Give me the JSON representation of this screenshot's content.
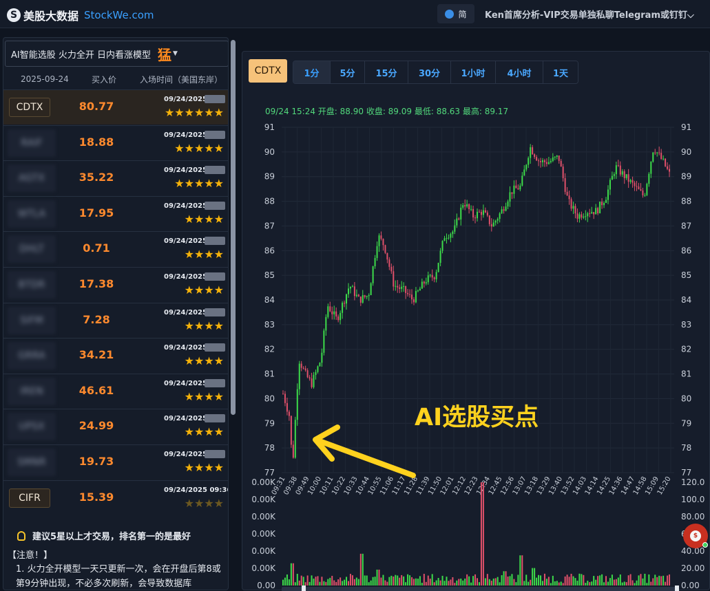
{
  "header": {
    "logo_mark": "S",
    "brand": "美股大数据",
    "site": "StockWe.com",
    "lang": "简",
    "user_menu": "Ken首席分析-VIP交易单独私聊Telegram或钉钉"
  },
  "picker": {
    "model": "AI智能选股 火力全开 日内看涨模型",
    "hot_tag": "猛",
    "date": "2025-09-24",
    "col_price": "买入价",
    "col_time": "入场时间（美国东岸）",
    "rows": [
      {
        "ticker": "CDTX",
        "price": "80.77",
        "time": "09/24/2025",
        "stars": "★★★★★★",
        "active": true
      },
      {
        "ticker": "RAIF",
        "price": "18.88",
        "time": "09/24/2025 09:",
        "stars": "★★★★★",
        "blur": true
      },
      {
        "ticker": "AGTX",
        "price": "35.22",
        "time": "09/24/2025",
        "stars": "★★★★★",
        "blur": true
      },
      {
        "ticker": "WTLA",
        "price": "17.95",
        "time": "09/24/2025",
        "stars": "★★★★",
        "blur": true
      },
      {
        "ticker": "DHLT",
        "price": "0.71",
        "time": "09/24/2025",
        "stars": "★★★★",
        "blur": true
      },
      {
        "ticker": "BTDR",
        "price": "17.38",
        "time": "09/24/2025",
        "stars": "★★★★",
        "blur": true
      },
      {
        "ticker": "SIFM",
        "price": "7.28",
        "time": "09/24/2025",
        "stars": "★★★★",
        "blur": true
      },
      {
        "ticker": "GRRA",
        "price": "34.21",
        "time": "09/24/2025 09:",
        "stars": "★★★★",
        "blur": true
      },
      {
        "ticker": "IREN",
        "price": "46.61",
        "time": "09/24/2025",
        "stars": "★★★★",
        "blur": true
      },
      {
        "ticker": "UPSX",
        "price": "24.99",
        "time": "09/24/2025 0",
        "stars": "★★★★",
        "blur": true
      },
      {
        "ticker": "SMNR",
        "price": "19.73",
        "time": "09/24/2025 09:",
        "stars": "★★★★",
        "blur": true
      },
      {
        "ticker": "CIFR",
        "price": "15.39",
        "time": "09/24/2025 09:36",
        "stars": "★★★★",
        "dim": true
      }
    ],
    "tip": "建议5星以上才交易，排名第一的是最好",
    "note_title": "【注意！】",
    "note_1": "1.  火力全开模型一天只更新一次，会在开盘后第8或第9分钟出现，不必多次刷新，会导致数据库"
  },
  "chart": {
    "ticker": "CDTX",
    "tabs": [
      "1分",
      "5分",
      "15分",
      "30分",
      "1小时",
      "4小时",
      "1天"
    ],
    "active_tab": "1分",
    "ohlc": "09/24 15:24   开盘: 88.90   收盘: 89.09   最低: 88.63   最高: 89.17",
    "annotation": "AI选股买点",
    "up_color": "#3ddc4a",
    "down_color": "#e0506a"
  },
  "chart_data": {
    "type": "candlestick",
    "price_axis": [
      91,
      90,
      89,
      88,
      87,
      86,
      85,
      84,
      83,
      82,
      81,
      80,
      79,
      78,
      77
    ],
    "ylim": [
      77,
      91
    ],
    "x_ticks": [
      "09:31",
      "09:38",
      "09:49",
      "10:00",
      "10:11",
      "10:22",
      "10:33",
      "10:44",
      "10:55",
      "11:06",
      "11:17",
      "11:28",
      "11:39",
      "11:50",
      "12:01",
      "12:12",
      "12:23",
      "12:34",
      "12:45",
      "12:56",
      "13:07",
      "13:18",
      "13:29",
      "13:40",
      "13:52",
      "14:03",
      "14:14",
      "14:25",
      "14:36",
      "14:47",
      "14:58",
      "15:09",
      "15:20"
    ],
    "vol_axis_left": [
      "0.00K",
      "0.00K",
      "0.00K",
      "0.00K",
      "0.00K",
      "0.00K",
      "0.00"
    ],
    "vol_axis_right": [
      "120.0",
      "100.0",
      "80.00",
      "60.00",
      "40.00",
      "20.00",
      "0.00"
    ],
    "price_path": [
      [
        0,
        80.2
      ],
      [
        4,
        79.3
      ],
      [
        6,
        77.2
      ],
      [
        10,
        81.6
      ],
      [
        14,
        81.0
      ],
      [
        18,
        80.6
      ],
      [
        24,
        81.6
      ],
      [
        28,
        83.8
      ],
      [
        34,
        83.2
      ],
      [
        42,
        84.6
      ],
      [
        48,
        84.0
      ],
      [
        54,
        84.2
      ],
      [
        60,
        86.6
      ],
      [
        64,
        86.2
      ],
      [
        70,
        84.6
      ],
      [
        76,
        84.4
      ],
      [
        82,
        84.0
      ],
      [
        90,
        84.8
      ],
      [
        96,
        85.0
      ],
      [
        102,
        86.6
      ],
      [
        108,
        86.8
      ],
      [
        114,
        88.0
      ],
      [
        120,
        87.4
      ],
      [
        126,
        87.6
      ],
      [
        132,
        87.0
      ],
      [
        138,
        87.6
      ],
      [
        144,
        88.4
      ],
      [
        150,
        88.6
      ],
      [
        156,
        90.2
      ],
      [
        162,
        89.6
      ],
      [
        168,
        89.6
      ],
      [
        174,
        89.8
      ],
      [
        180,
        88.0
      ],
      [
        186,
        87.4
      ],
      [
        192,
        87.6
      ],
      [
        198,
        87.6
      ],
      [
        204,
        88.2
      ],
      [
        210,
        89.4
      ],
      [
        216,
        89.0
      ],
      [
        222,
        88.6
      ],
      [
        228,
        88.2
      ],
      [
        234,
        90.2
      ],
      [
        240,
        89.6
      ],
      [
        244,
        89.1
      ]
    ],
    "volume_peaks": [
      [
        6,
        28
      ],
      [
        50,
        40
      ],
      [
        60,
        20
      ],
      [
        120,
        12
      ],
      [
        126,
        130
      ],
      [
        140,
        18
      ],
      [
        150,
        38
      ],
      [
        158,
        22
      ]
    ]
  }
}
